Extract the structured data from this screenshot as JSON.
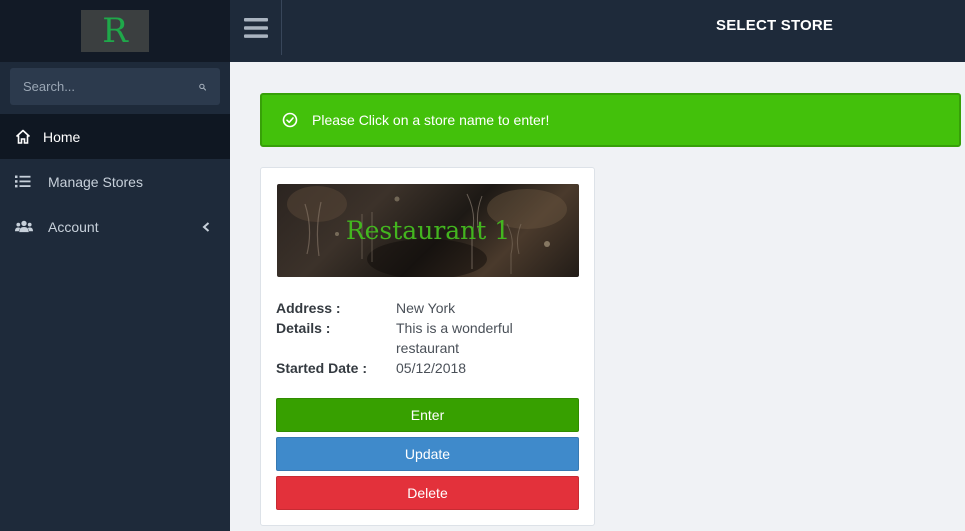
{
  "logo": {
    "letter": "R"
  },
  "search": {
    "placeholder": "Search..."
  },
  "sidebar": {
    "items": [
      {
        "label": "Home",
        "icon": "home-icon",
        "active": true
      },
      {
        "label": "Manage Stores",
        "icon": "list-icon"
      },
      {
        "label": "Account",
        "icon": "users-icon",
        "has_submenu": true
      }
    ]
  },
  "header": {
    "title": "SELECT STORE"
  },
  "alert": {
    "message": "Please Click on a store name to enter!"
  },
  "store": {
    "name": "Restaurant 1",
    "address_label": "Address :",
    "address": "New York",
    "details_label": "Details :",
    "details": "This is a wonderful restaurant",
    "started_label": "Started Date :",
    "started": "05/12/2018",
    "enter_label": "Enter",
    "update_label": "Update",
    "delete_label": "Delete"
  },
  "colors": {
    "sidebar_bg": "#1e2a3a",
    "alert_green": "#43c10b",
    "enter_green": "#37a000",
    "update_blue": "#3f8acb",
    "delete_red": "#e3313b",
    "logo_green": "#1fa84a"
  }
}
